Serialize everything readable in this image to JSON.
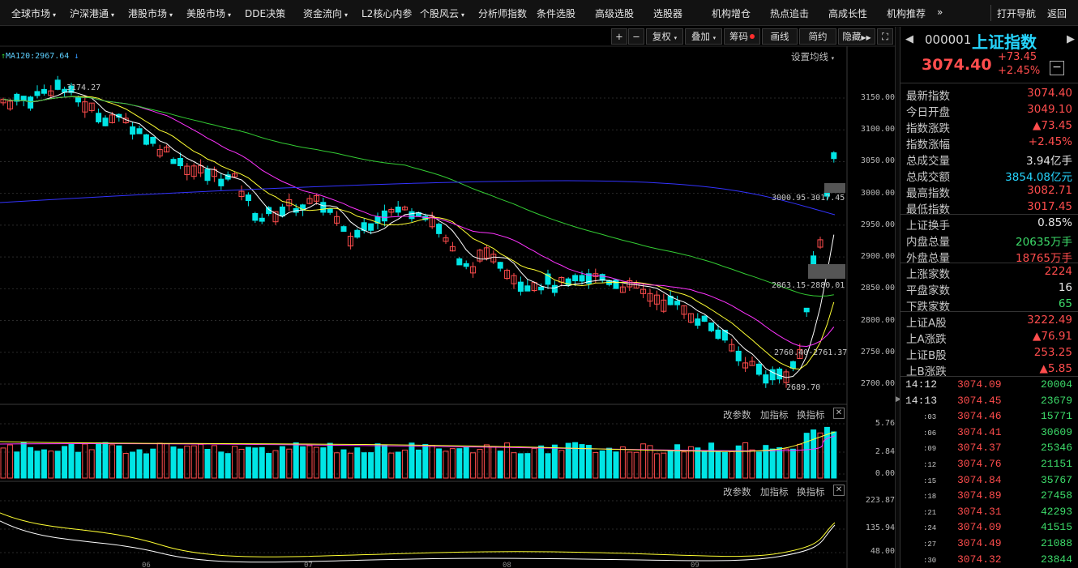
{
  "menu": [
    {
      "label": "全球市场",
      "caret": true
    },
    {
      "label": "沪深港通",
      "caret": true
    },
    {
      "label": "港股市场",
      "caret": true
    },
    {
      "label": "美股市场",
      "caret": true
    },
    {
      "label": "DDE决策",
      "caret": false
    },
    {
      "label": "资金流向",
      "caret": true
    },
    {
      "label": "L2核心内参",
      "caret": false
    },
    {
      "label": "个股风云",
      "caret": true
    },
    {
      "label": "分析师指数",
      "caret": false
    },
    {
      "label": "条件选股",
      "caret": false
    },
    {
      "label": "高级选股",
      "caret": false
    },
    {
      "label": "选股器",
      "caret": false
    },
    {
      "label": "机构增仓",
      "caret": false
    },
    {
      "label": "热点追击",
      "caret": false
    },
    {
      "label": "高成长性",
      "caret": false
    },
    {
      "label": "机构推荐",
      "caret": false
    }
  ],
  "menu_more": "»",
  "menu_right": {
    "nav": "打开导航",
    "back": "返回"
  },
  "toolbar": {
    "plus": "+",
    "minus": "−",
    "restore": "复权",
    "overlay": "叠加",
    "chips": "筹码",
    "draw": "画线",
    "simple": "简约",
    "hide": "隐藏"
  },
  "ma_label": "MA120:2967.64",
  "set_ma": "设置均线",
  "sub_controls": {
    "params": "改参数",
    "add": "加指标",
    "switch": "换指标"
  },
  "price_axis": [
    "3150.00",
    "3100.00",
    "3050.00",
    "3000.00",
    "2950.00",
    "2900.00",
    "2850.00",
    "2800.00",
    "2750.00",
    "2700.00"
  ],
  "vol_axis": [
    "5.76",
    "2.84",
    "0.00"
  ],
  "ind_axis": [
    "223.87",
    "135.94",
    "48.00"
  ],
  "annotations": {
    "high": "3174.27",
    "low": "2689.70",
    "gap1": "3000.95-3017.45",
    "gap2": "2863.15-2880.01",
    "gap3": "2760.40-2761.37"
  },
  "month_labels": [
    "06",
    "07",
    "08",
    "09"
  ],
  "panel": {
    "code": "000001",
    "name": "上证指数",
    "price": "3074.40",
    "change": "+73.45",
    "change_pct": "+2.45%",
    "stats": [
      {
        "label": "最新指数",
        "value": "3074.40",
        "color": "#ff4d4d"
      },
      {
        "label": "今日开盘",
        "value": "3049.10",
        "color": "#ff4d4d"
      },
      {
        "label": "指数涨跌",
        "value": "▲73.45",
        "color": "#ff4d4d"
      },
      {
        "label": "指数涨幅",
        "value": "+2.45%",
        "color": "#ff4d4d"
      },
      {
        "label": "总成交量",
        "value": "3.94亿手",
        "color": "#e6e6e6"
      },
      {
        "label": "总成交额",
        "value": "3854.08亿元",
        "color": "#26d6ff"
      },
      {
        "label": "最高指数",
        "value": "3082.71",
        "color": "#ff4d4d"
      },
      {
        "label": "最低指数",
        "value": "3017.45",
        "color": "#ff4d4d"
      },
      {
        "label": "上证换手",
        "value": "0.85%",
        "color": "#e6e6e6"
      },
      {
        "label": "内盘总量",
        "value": "20635万手",
        "color": "#3ddc6a"
      },
      {
        "label": "外盘总量",
        "value": "18765万手",
        "color": "#ff4d4d"
      },
      {
        "label": "上涨家数",
        "value": "2224",
        "color": "#ff4d4d"
      },
      {
        "label": "平盘家数",
        "value": "16",
        "color": "#e6e6e6"
      },
      {
        "label": "下跌家数",
        "value": "65",
        "color": "#3ddc6a"
      },
      {
        "label": "上证A股",
        "value": "3222.49",
        "color": "#ff4d4d"
      },
      {
        "label": "上A涨跌",
        "value": "▲76.91",
        "color": "#ff4d4d"
      },
      {
        "label": "上证B股",
        "value": "253.25",
        "color": "#ff4d4d"
      },
      {
        "label": "上B涨跌",
        "value": "▲5.85",
        "color": "#ff4d4d"
      }
    ],
    "ticks": [
      {
        "time": "14:12",
        "price": "3074.09",
        "vol": "20004",
        "big": true
      },
      {
        "time": "14:13",
        "price": "3074.45",
        "vol": "23679",
        "big": true
      },
      {
        "time": ":03",
        "price": "3074.46",
        "vol": "15771",
        "big": false
      },
      {
        "time": ":06",
        "price": "3074.41",
        "vol": "30609",
        "big": false
      },
      {
        "time": ":09",
        "price": "3074.37",
        "vol": "25346",
        "big": false
      },
      {
        "time": ":12",
        "price": "3074.76",
        "vol": "21151",
        "big": false
      },
      {
        "time": ":15",
        "price": "3074.84",
        "vol": "35767",
        "big": false
      },
      {
        "time": ":18",
        "price": "3074.89",
        "vol": "27458",
        "big": false
      },
      {
        "time": ":21",
        "price": "3074.31",
        "vol": "42293",
        "big": false
      },
      {
        "time": ":24",
        "price": "3074.09",
        "vol": "41515",
        "big": false
      },
      {
        "time": ":27",
        "price": "3074.49",
        "vol": "21088",
        "big": false
      },
      {
        "time": ":30",
        "price": "3074.32",
        "vol": "23844",
        "big": false
      }
    ]
  },
  "colors": {
    "up": "#ff4d4d",
    "down": "#00e5e5",
    "ma5": "#ffffff",
    "ma10": "#ffff33",
    "ma20": "#ff33ff",
    "ma60": "#33cc33",
    "ma120": "#3333ff"
  }
}
